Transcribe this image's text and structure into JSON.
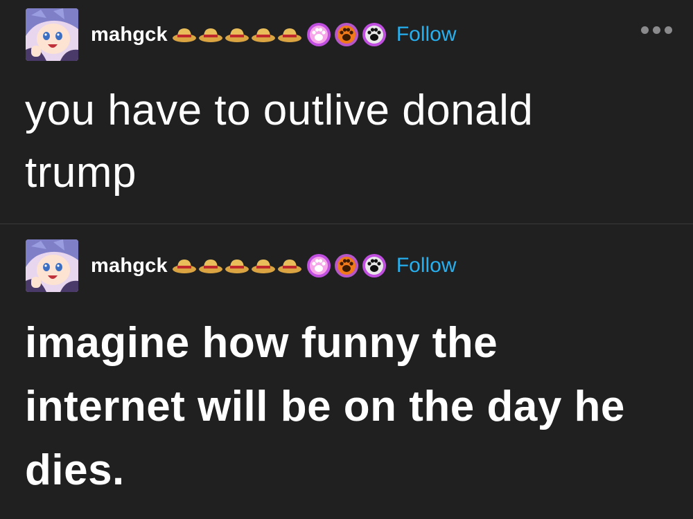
{
  "posts": [
    {
      "username": "mahgck",
      "follow_label": "Follow",
      "text": "you have to outlive donald trump",
      "has_more_menu": true
    },
    {
      "username": "mahgck",
      "follow_label": "Follow",
      "text": "imagine how funny the internet will be on the day he dies.",
      "has_more_menu": false
    }
  ],
  "badges": {
    "hats": [
      "straw-hat-icon",
      "straw-hat-icon",
      "straw-hat-icon",
      "straw-hat-icon",
      "straw-hat-icon"
    ],
    "paws": [
      {
        "name": "pink-paw-badge-icon",
        "bg": "#c04fe0",
        "paw": "#ffffff"
      },
      {
        "name": "orange-paw-badge-icon",
        "bg": "#f07a1a",
        "paw": "#3a1a00"
      },
      {
        "name": "black-paw-badge-icon",
        "bg": "#c04fe0",
        "paw": "#111111"
      }
    ]
  },
  "colors": {
    "background": "#202021",
    "text": "#ffffff",
    "follow": "#27b0ef",
    "divider": "#3a3a3b"
  }
}
